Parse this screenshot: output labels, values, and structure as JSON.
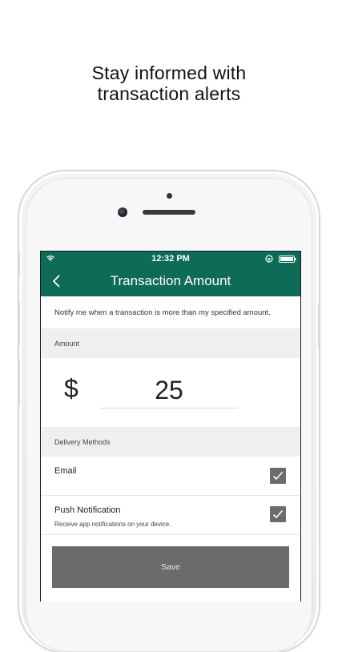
{
  "headline": {
    "line1": "Stay informed with",
    "line2": "transaction alerts"
  },
  "status_bar": {
    "time": "12:32 PM"
  },
  "nav": {
    "title": "Transaction Amount"
  },
  "intro_text": "Notify me when a transaction is more than my specified amount.",
  "amount": {
    "section_label": "Amount",
    "currency_symbol": "$",
    "value": "25"
  },
  "delivery": {
    "section_label": "Delivery Methods",
    "email": {
      "label": "Email",
      "checked": true
    },
    "push": {
      "label": "Push Notification",
      "description": "Receive app notifications on your device.",
      "checked": true
    }
  },
  "save_label": "Save",
  "colors": {
    "brand_green": "#0e6b57",
    "checkbox_gray": "#6b6b6b",
    "section_gray": "#efefef"
  }
}
